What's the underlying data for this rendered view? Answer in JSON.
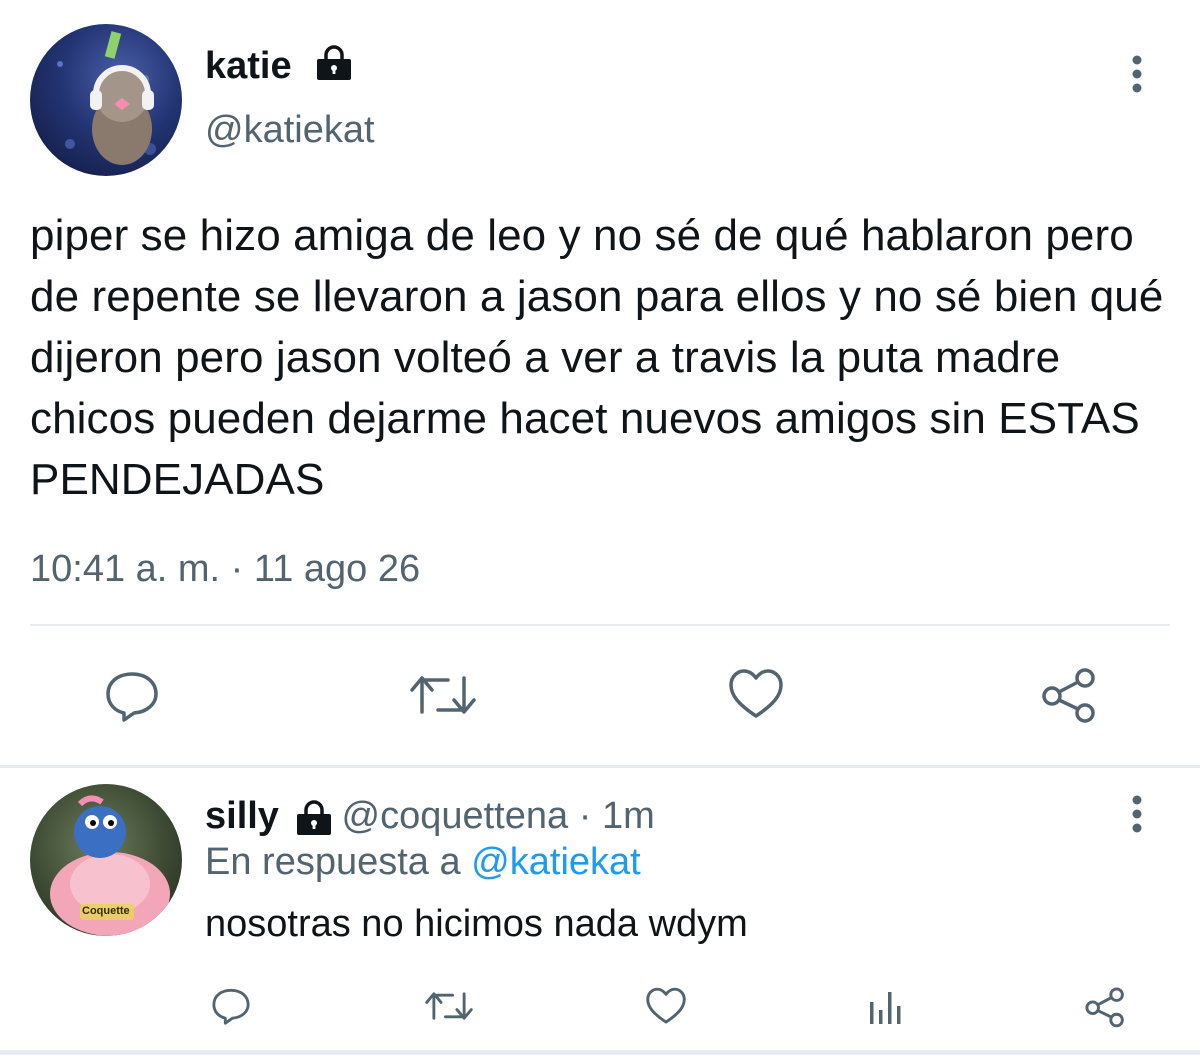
{
  "tweet": {
    "display_name": "katie",
    "handle": "@katiekat",
    "text": "piper se hizo amiga de leo y no sé de qué hablaron pero de repente se llevaron a jason para ellos y no sé bien qué dijeron pero jason volteó a ver a travis la puta madre chicos pueden dejarme hacet nuevos amigos sin ESTAS PENDEJADAS",
    "timestamp": "10:41 a. m. · 11 ago 26",
    "actions": [
      "reply-icon",
      "retweet-icon",
      "like-icon",
      "share-icon"
    ]
  },
  "reply": {
    "display_name": "silly",
    "handle": "@coquettena",
    "separator": "·",
    "time": "1m",
    "in_reply_prefix": "En respuesta a",
    "in_reply_handle": "@katiekat",
    "text": "nosotras no hicimos nada wdym",
    "avatar_label": "Coquette",
    "actions": [
      "reply-icon",
      "retweet-icon",
      "like-icon",
      "analytics-icon",
      "share-icon"
    ]
  },
  "colors": {
    "text": "#0f1419",
    "muted": "#536471",
    "link": "#1d9bf0",
    "divider": "#e6ecf0"
  }
}
